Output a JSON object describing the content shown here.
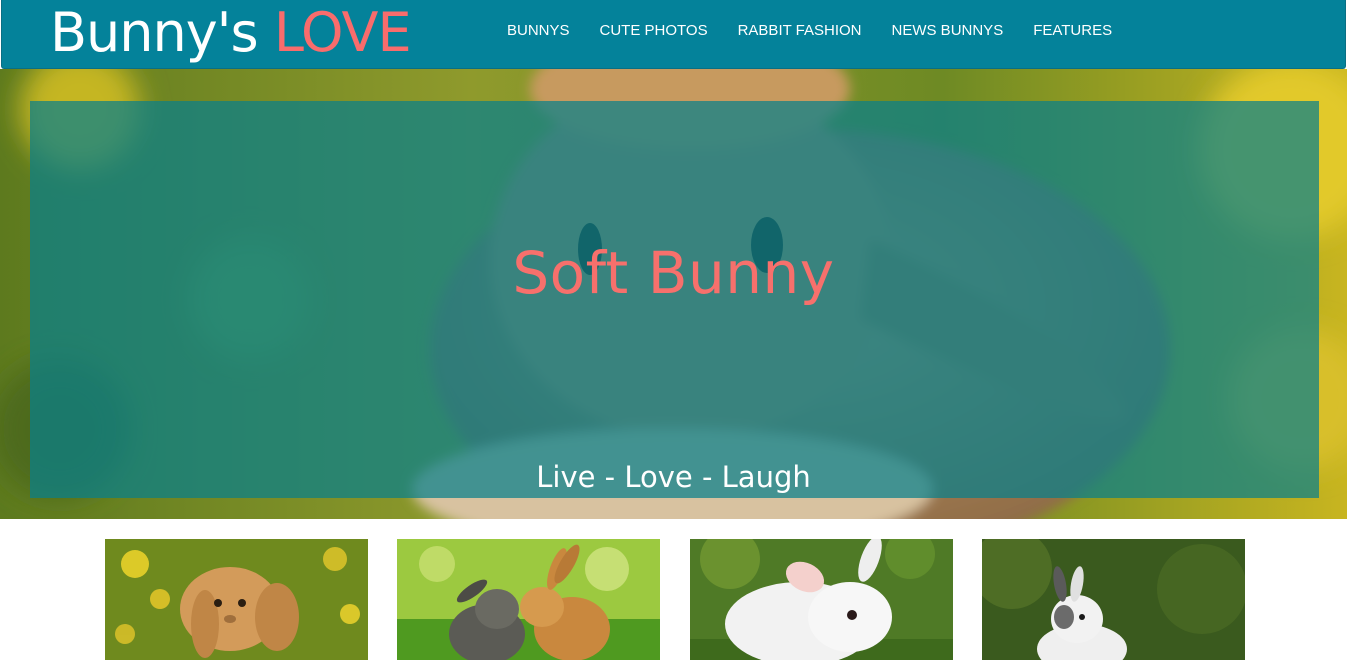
{
  "brand": {
    "name_part1": "Bunny's",
    "name_part2": "LOVE"
  },
  "nav": {
    "items": [
      {
        "label": "BUNNYS"
      },
      {
        "label": "CUTE PHOTOS"
      },
      {
        "label": "RABBIT FASHION"
      },
      {
        "label": "NEWS BUNNYS"
      },
      {
        "label": "FEATURES"
      }
    ]
  },
  "hero": {
    "title": "Soft Bunny",
    "tagline": "Live - Love - Laugh"
  },
  "colors": {
    "header": "#04829a",
    "accent": "#f96c6c",
    "overlay": "#08808a"
  },
  "gallery": {
    "items": [
      {
        "icon": "lop-eared-bunny-image"
      },
      {
        "icon": "kissing-bunnies-image"
      },
      {
        "icon": "white-bunny-image"
      },
      {
        "icon": "spotted-bunny-image"
      }
    ]
  }
}
